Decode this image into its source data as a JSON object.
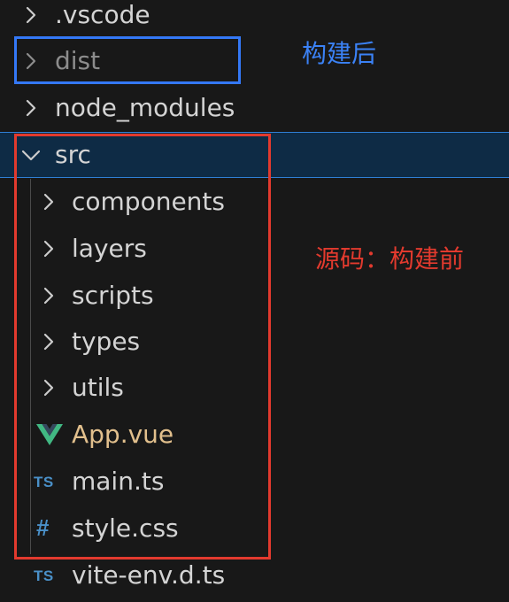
{
  "explorer": {
    "items": [
      {
        "label": ".vscode",
        "type": "folder"
      },
      {
        "label": "dist",
        "type": "folder"
      },
      {
        "label": "node_modules",
        "type": "folder"
      },
      {
        "label": "src",
        "type": "folder",
        "state": "expanded",
        "selected": true
      },
      {
        "label": "components",
        "type": "folder"
      },
      {
        "label": "layers",
        "type": "folder"
      },
      {
        "label": "scripts",
        "type": "folder"
      },
      {
        "label": "types",
        "type": "folder"
      },
      {
        "label": "utils",
        "type": "folder"
      },
      {
        "label": "App.vue",
        "type": "file",
        "icon": "vue-icon",
        "glyph": ""
      },
      {
        "label": "main.ts",
        "type": "file",
        "icon": "typescript-icon",
        "glyph": "TS"
      },
      {
        "label": "style.css",
        "type": "file",
        "icon": "css-icon",
        "glyph": "#"
      },
      {
        "label": "vite-env.d.ts",
        "type": "file",
        "icon": "typescript-icon",
        "glyph": "TS"
      }
    ]
  },
  "annotations": {
    "dist_note": "构建后",
    "src_note": "源码：构建前"
  },
  "colors": {
    "background": "#181818",
    "selected_row": "#0e2b45",
    "selection_border": "#2f7fd4",
    "text": "#d4d4d4",
    "dimmed_text": "#8c8c8c",
    "vue_text": "#e2c08d",
    "vue_icon": "#41b883",
    "ts_icon": "#4a90c8",
    "annotation_blue": "#3b82f6",
    "annotation_red": "#e23a2e"
  }
}
